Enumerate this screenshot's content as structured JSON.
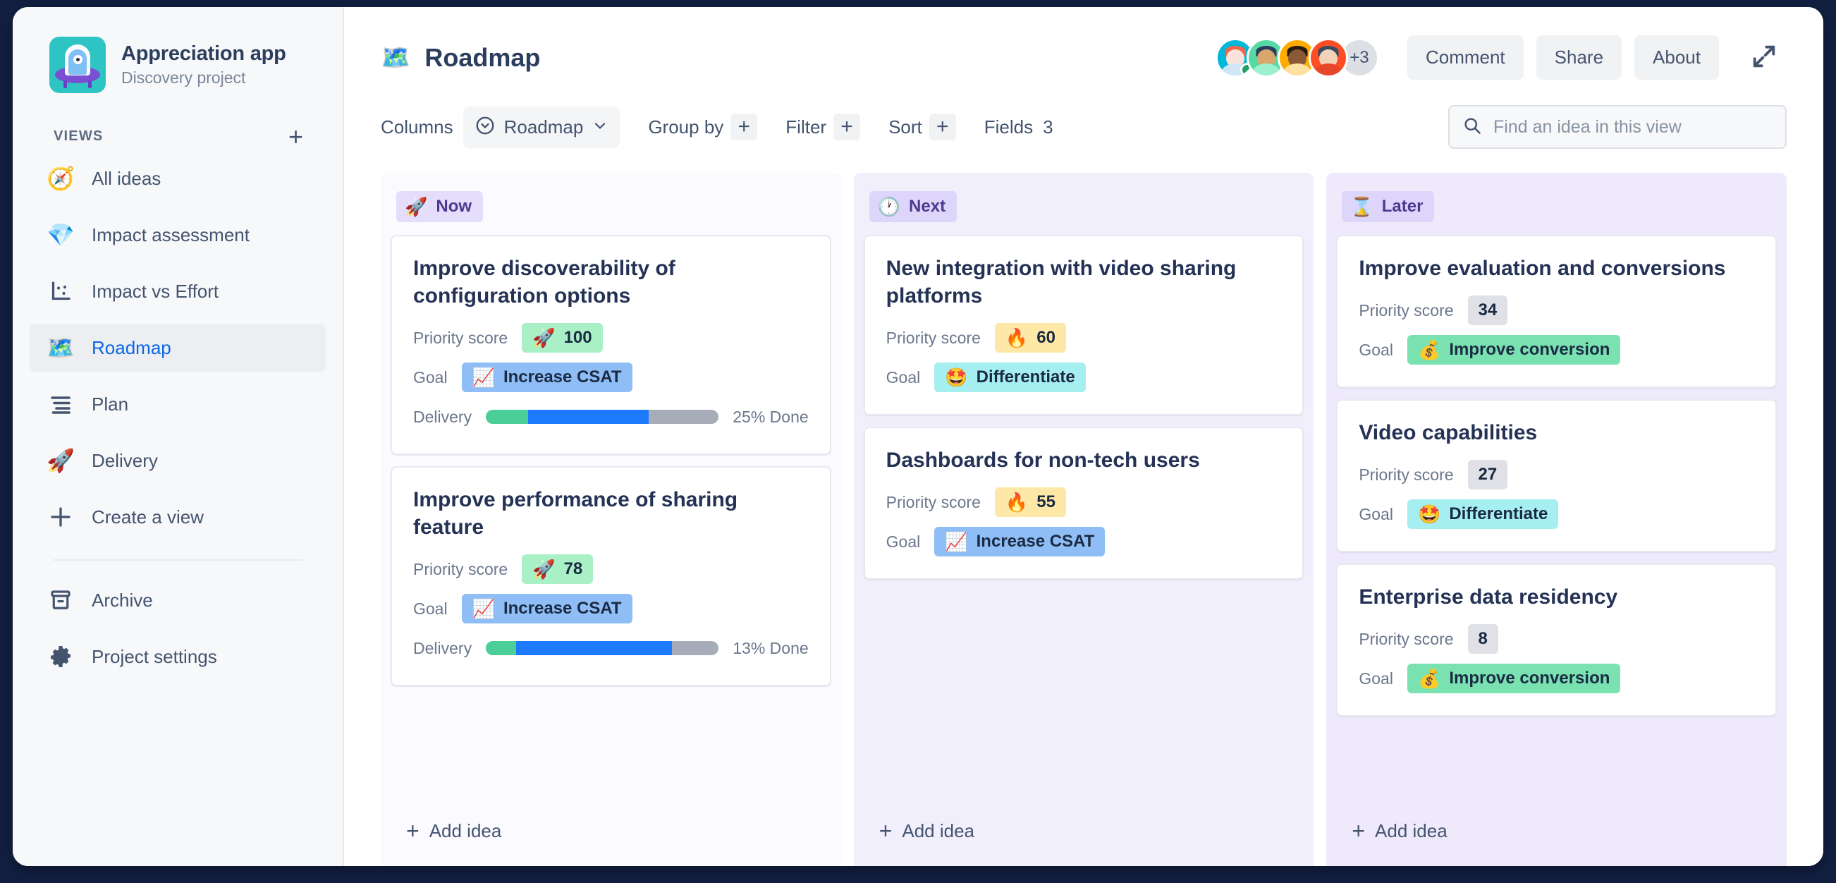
{
  "sidebar": {
    "project": {
      "title": "Appreciation app",
      "subtitle": "Discovery project",
      "logo_icon": "ufo-app-logo"
    },
    "views_label": "VIEWS",
    "add_view_icon": "plus-icon",
    "items": [
      {
        "label": "All ideas",
        "icon": "compass-emoji",
        "emoji": "🧭",
        "active": false
      },
      {
        "label": "Impact assessment",
        "icon": "gem-emoji",
        "emoji": "💎",
        "active": false
      },
      {
        "label": "Impact vs Effort",
        "icon": "scatter-chart-icon",
        "emoji": "",
        "active": false
      },
      {
        "label": "Roadmap",
        "icon": "world-map-emoji",
        "emoji": "🗺️",
        "active": true
      },
      {
        "label": "Plan",
        "icon": "list-lines-icon",
        "emoji": "",
        "active": false
      },
      {
        "label": "Delivery",
        "icon": "rocket-emoji",
        "emoji": "🚀",
        "active": false
      },
      {
        "label": "Create a view",
        "icon": "plus-icon",
        "emoji": "",
        "active": false
      }
    ],
    "bottom_items": [
      {
        "label": "Archive",
        "icon": "archive-box-icon"
      },
      {
        "label": "Project settings",
        "icon": "gear-icon"
      }
    ]
  },
  "header": {
    "view_emoji": "🗺️",
    "title": "Roadmap",
    "avatars_overflow": "+3",
    "buttons": [
      {
        "label": "Comment",
        "name": "comment-button"
      },
      {
        "label": "Share",
        "name": "share-button"
      },
      {
        "label": "About",
        "name": "about-button"
      }
    ],
    "expand_icon": "expand-diagonal-icon"
  },
  "toolbar": {
    "columns_label": "Columns",
    "columns_value": "Roadmap",
    "columns_value_icon": "chevron-down-circle-icon",
    "columns_chevron": "chevron-down-icon",
    "group_by_label": "Group by",
    "group_by_add": "+",
    "filter_label": "Filter",
    "filter_add": "+",
    "sort_label": "Sort",
    "sort_add": "+",
    "fields_label": "Fields",
    "fields_count": "3",
    "search_icon": "search-icon",
    "search_placeholder": "Find an idea in this view",
    "search_value": ""
  },
  "board": {
    "add_idea_label": "Add idea",
    "priority_label": "Priority score",
    "goal_label": "Goal",
    "delivery_label": "Delivery",
    "columns": [
      {
        "name": "Now",
        "emoji": "🚀",
        "cards": [
          {
            "title": "Improve discoverability of configuration options",
            "score": "100",
            "score_emoji": "🚀",
            "score_style": "green",
            "goal": "Increase CSAT",
            "goal_emoji": "📈",
            "goal_style": "csat",
            "delivery_text": "25% Done",
            "delivery_green_pct": 18,
            "delivery_blue_pct": 52
          },
          {
            "title": "Improve performance of sharing feature",
            "score": "78",
            "score_emoji": "🚀",
            "score_style": "green",
            "goal": "Increase CSAT",
            "goal_emoji": "📈",
            "goal_style": "csat",
            "delivery_text": "13% Done",
            "delivery_green_pct": 13,
            "delivery_blue_pct": 67
          }
        ]
      },
      {
        "name": "Next",
        "emoji": "🕐",
        "cards": [
          {
            "title": "New integration with video sharing platforms",
            "score": "60",
            "score_emoji": "🔥",
            "score_style": "orange",
            "goal": "Differentiate",
            "goal_emoji": "🤩",
            "goal_style": "diff",
            "delivery_text": "",
            "delivery_green_pct": 0,
            "delivery_blue_pct": 0
          },
          {
            "title": "Dashboards for non-tech users",
            "score": "55",
            "score_emoji": "🔥",
            "score_style": "orange",
            "goal": "Increase CSAT",
            "goal_emoji": "📈",
            "goal_style": "csat",
            "delivery_text": "",
            "delivery_green_pct": 0,
            "delivery_blue_pct": 0
          }
        ]
      },
      {
        "name": "Later",
        "emoji": "⌛",
        "cards": [
          {
            "title": "Improve evaluation and conversions",
            "score": "34",
            "score_emoji": "",
            "score_style": "grey",
            "goal": "Improve conversion",
            "goal_emoji": "💰",
            "goal_style": "conv",
            "delivery_text": "",
            "delivery_green_pct": 0,
            "delivery_blue_pct": 0
          },
          {
            "title": "Video capabilities",
            "score": "27",
            "score_emoji": "",
            "score_style": "grey",
            "goal": "Differentiate",
            "goal_emoji": "🤩",
            "goal_style": "diff",
            "delivery_text": "",
            "delivery_green_pct": 0,
            "delivery_blue_pct": 0
          },
          {
            "title": "Enterprise data residency",
            "score": "8",
            "score_emoji": "",
            "score_style": "grey",
            "goal": "Improve conversion",
            "goal_emoji": "💰",
            "goal_style": "conv",
            "delivery_text": "",
            "delivery_green_pct": 0,
            "delivery_blue_pct": 0
          }
        ]
      }
    ]
  },
  "colors": {
    "accent": "#0c66e4",
    "text": "#44546f",
    "heading": "#243255",
    "column_now_bg": "#fafaff",
    "column_next_bg": "#f2effd",
    "column_later_bg": "#eeeafc",
    "pill_bg": "#ddd6fa",
    "window_bg": "#121f41"
  }
}
